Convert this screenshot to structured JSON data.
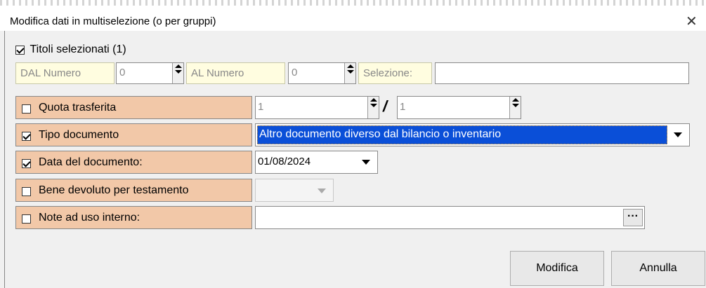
{
  "window": {
    "title": "Modifica dati in multiselezione (o per gruppi)",
    "close_glyph": "✕"
  },
  "selected_titles": {
    "label": "Titoli selezionati (1)",
    "checked": true
  },
  "range": {
    "from_label": "DAL Numero",
    "from_value": "0",
    "to_label": "AL Numero",
    "to_value": "0",
    "selection_label": "Selezione:",
    "selection_value": ""
  },
  "rows": [
    {
      "label": "Quota trasferita",
      "checked": false
    },
    {
      "label": "Tipo documento",
      "checked": true
    },
    {
      "label": "Data del documento:",
      "checked": true
    },
    {
      "label": "Bene devoluto per testamento",
      "checked": false
    },
    {
      "label": "Note ad uso interno:",
      "checked": false
    }
  ],
  "quota": {
    "numerator": "1",
    "separator": "/",
    "denominator": "1"
  },
  "tipo_documento": {
    "value": "Altro documento diverso dal bilancio o inventario"
  },
  "data_documento": {
    "value": "01/08/2024"
  },
  "bene_devoluto": {
    "value": ""
  },
  "note": {
    "value": "",
    "ellipsis": "···"
  },
  "buttons": {
    "modifica": "Modifica",
    "annulla": "Annulla"
  },
  "colors": {
    "peach": "#f2c8a8",
    "highlight": "#0a4fd8",
    "label_bg": "#fffde0"
  }
}
